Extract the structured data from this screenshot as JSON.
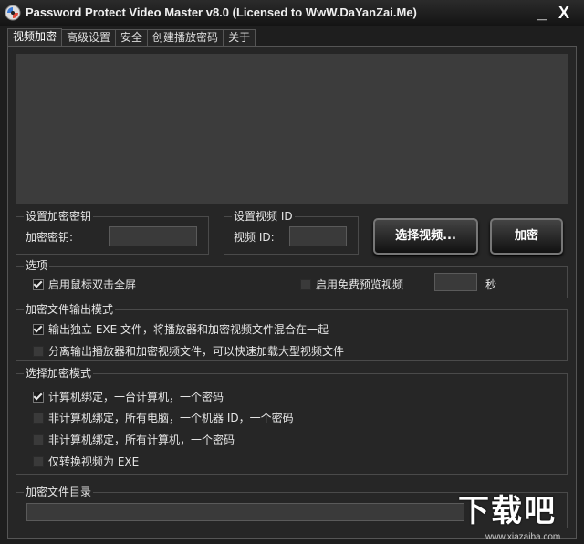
{
  "window": {
    "title": "Password Protect Video Master v8.0 (Licensed to WwW.DaYanZai.Me)",
    "minimize": "_",
    "close": "X"
  },
  "tabs": [
    {
      "label": "视频加密",
      "active": true
    },
    {
      "label": "高级设置",
      "active": false
    },
    {
      "label": "安全",
      "active": false
    },
    {
      "label": "创建播放密码",
      "active": false
    },
    {
      "label": "关于",
      "active": false
    }
  ],
  "key_group": {
    "title": "设置加密密钥",
    "label": "加密密钥:",
    "value": ""
  },
  "id_group": {
    "title": "设置视频 ID",
    "label": "视频 ID:",
    "value": ""
  },
  "buttons": {
    "select_video": "选择视频...",
    "encrypt": "加密"
  },
  "options": {
    "title": "选项",
    "fullscreen": {
      "label": "启用鼠标双击全屏",
      "checked": true
    },
    "preview": {
      "label": "启用免费预览视频",
      "checked": false
    },
    "preview_seconds": "",
    "seconds_unit": "秒"
  },
  "output_mode": {
    "title": "加密文件输出模式",
    "items": [
      {
        "label": "输出独立 EXE 文件，将播放器和加密视频文件混合在一起",
        "checked": true
      },
      {
        "label": "分离输出播放器和加密视频文件，可以快速加载大型视频文件",
        "checked": false
      }
    ]
  },
  "encrypt_mode": {
    "title": "选择加密模式",
    "items": [
      {
        "label": "计算机绑定，一台计算机，一个密码",
        "checked": true
      },
      {
        "label": "非计算机绑定，所有电脑，一个机器 ID，一个密码",
        "checked": false
      },
      {
        "label": "非计算机绑定，所有计算机，一个密码",
        "checked": false
      },
      {
        "label": "仅转换视频为 EXE",
        "checked": false
      }
    ]
  },
  "output_dir": {
    "title": "加密文件目录",
    "value": ""
  },
  "watermark": {
    "main": "下载吧",
    "sub": "www.xiazaiba.com"
  },
  "colors": {
    "background": "#262626",
    "video_area": "#3c3c3c"
  }
}
